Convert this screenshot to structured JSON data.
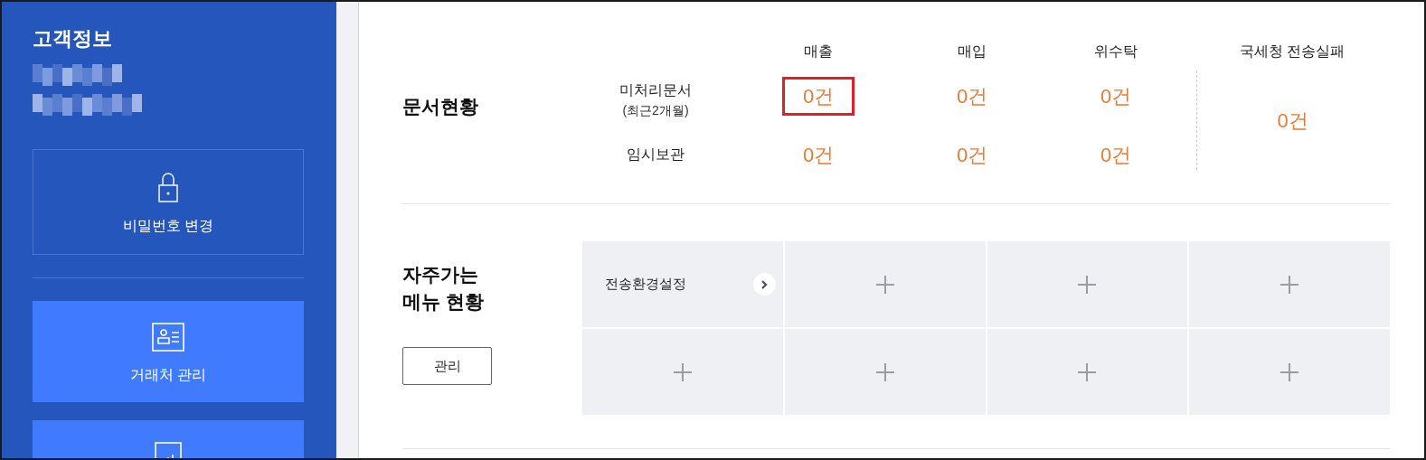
{
  "sidebar": {
    "title": "고객정보",
    "buttons": [
      {
        "label": "비밀번호 변경",
        "kind": "outline"
      },
      {
        "label": "거래처 관리",
        "kind": "filled"
      },
      {
        "kind": "filled"
      }
    ]
  },
  "documents": {
    "title": "문서현황",
    "columns": [
      "매출",
      "매입",
      "위수탁"
    ],
    "rows": [
      {
        "label": "미처리문서",
        "sublabel": "(최근2개월)",
        "values": [
          {
            "text": "0건",
            "highlighted": true
          },
          {
            "text": "0건",
            "highlighted": false
          },
          {
            "text": "0건",
            "highlighted": false
          }
        ]
      },
      {
        "label": "임시보관",
        "values": [
          {
            "text": "0건",
            "highlighted": false
          },
          {
            "text": "0건",
            "highlighted": false
          },
          {
            "text": "0건",
            "highlighted": false
          }
        ]
      }
    ],
    "failure": {
      "label": "국세청 전송실패",
      "value": "0건"
    }
  },
  "favorites": {
    "title_lines": [
      "자주가는",
      "메뉴 현황"
    ],
    "manage_button": "관리",
    "slots": [
      {
        "kind": "link",
        "label": "전송환경설정"
      },
      {
        "kind": "empty"
      },
      {
        "kind": "empty"
      },
      {
        "kind": "empty"
      },
      {
        "kind": "empty"
      },
      {
        "kind": "empty"
      },
      {
        "kind": "empty"
      },
      {
        "kind": "empty"
      }
    ]
  }
}
